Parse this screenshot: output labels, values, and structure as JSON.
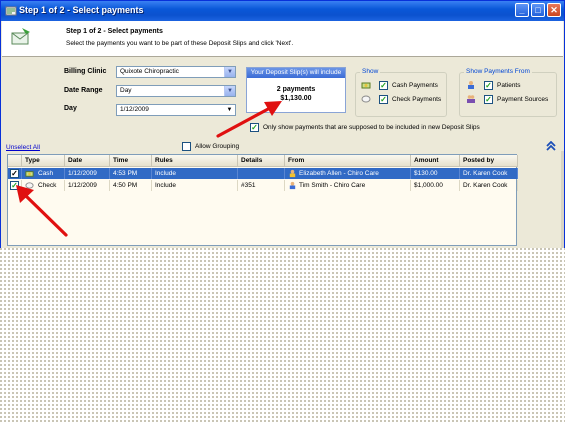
{
  "window": {
    "title": "Step 1 of 2 - Select payments",
    "minimize": "_",
    "maximize": "□",
    "close": "✕"
  },
  "header": {
    "step_title": "Step 1 of 2 - Select payments",
    "instructions": "Select the payments you want to be part of these Deposit Slips and click 'Next'."
  },
  "filters": {
    "billing_clinic_label": "Billing Clinic",
    "billing_clinic_value": "Quixote Chiropractic",
    "date_range_label": "Date Range",
    "date_range_value": "Day",
    "day_label": "Day",
    "day_value": "1/12/2009"
  },
  "deposit_slip": {
    "header": "Your Deposit Slip(s) will include",
    "count": "2 payments",
    "total": "$1,130.00"
  },
  "show": {
    "title": "Show",
    "cash_label": "Cash Payments",
    "check_label": "Check Payments",
    "cash_checked": true,
    "check_checked": true
  },
  "show_from": {
    "title": "Show Payments From",
    "patients_label": "Patients",
    "sources_label": "Payment Sources",
    "patients_checked": true,
    "sources_checked": true
  },
  "options": {
    "only_show_label": "Only show payments that are supposed to be included in new Deposit Slips",
    "only_show_checked": true,
    "allow_grouping_label": "Allow Grouping",
    "allow_grouping_checked": false,
    "unselect_all": "Unselect All"
  },
  "table": {
    "columns": [
      "",
      "Type",
      "Date",
      "Time",
      "Rules",
      "Details",
      "From",
      "Amount",
      "Posted by"
    ],
    "rows": [
      {
        "checked": true,
        "type": "Cash",
        "date": "1/12/2009",
        "time": "4:53 PM",
        "rules": "Include",
        "details": "",
        "from": "Elizabeth Allen - Chiro Care",
        "amount": "$130.00",
        "posted_by": "Dr. Karen Cook",
        "selected": true
      },
      {
        "checked": true,
        "type": "Check",
        "date": "1/12/2009",
        "time": "4:50 PM",
        "rules": "Include",
        "details": "#351",
        "from": "Tim Smith - Chiro Care",
        "amount": "$1,000.00",
        "posted_by": "Dr. Karen Cook",
        "selected": false
      }
    ]
  },
  "colors": {
    "title_bar": "#0a58d8",
    "selection": "#316ac5",
    "annotation_arrow": "#e01010"
  }
}
